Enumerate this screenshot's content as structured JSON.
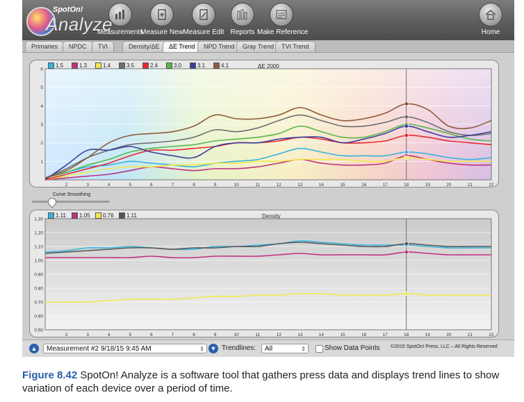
{
  "app": {
    "logo_small": "SpotOn!",
    "logo_large": "Analyze"
  },
  "toolbar": {
    "buttons": [
      {
        "label": "Measurements",
        "icon": "bar-chart-icon"
      },
      {
        "label": "Measure New",
        "icon": "document-plus-icon"
      },
      {
        "label": "Measure Edit",
        "icon": "document-edit-icon"
      },
      {
        "label": "Reports",
        "icon": "reports-icon"
      },
      {
        "label": "Make Reference",
        "icon": "reference-icon"
      }
    ],
    "home_label": "Home"
  },
  "tabs": [
    "Primaries",
    "NPDC",
    "TVI",
    "Density/ΔE",
    "ΔE Trend",
    "NPD Trend",
    "Gray Trend",
    "TVI Trend"
  ],
  "active_tab": "ΔE Trend",
  "smoothing": {
    "label": "Curve Smoothing",
    "value_fraction": 0.25
  },
  "charts": {
    "de": {
      "title": "ΔE 2000",
      "x": [
        1,
        2,
        3,
        4,
        5,
        6,
        7,
        8,
        9,
        10,
        11,
        12,
        13,
        14,
        15,
        16,
        17,
        18,
        19,
        20,
        21,
        22
      ],
      "xlim": [
        1,
        22
      ],
      "ylim": [
        0,
        6
      ],
      "yticks": [
        1,
        2,
        3,
        4,
        5,
        6
      ],
      "marker_x": 18,
      "series": [
        {
          "name": "1.5",
          "color": "#37b3dd",
          "values": [
            0.1,
            0.4,
            0.7,
            0.8,
            1.0,
            0.9,
            0.8,
            0.7,
            0.9,
            1.0,
            1.1,
            1.4,
            1.7,
            1.5,
            1.3,
            1.3,
            1.3,
            1.5,
            1.4,
            1.2,
            1.1,
            1.2
          ]
        },
        {
          "name": "1.3",
          "color": "#c0307f",
          "values": [
            0.0,
            0.1,
            0.2,
            0.3,
            0.5,
            0.7,
            0.6,
            0.5,
            0.6,
            0.6,
            0.7,
            0.9,
            1.1,
            0.9,
            0.8,
            0.8,
            0.9,
            1.3,
            1.1,
            0.9,
            0.8,
            0.8
          ]
        },
        {
          "name": "1.4",
          "color": "#f3e84a",
          "values": [
            0.0,
            0.2,
            0.4,
            0.6,
            0.7,
            0.7,
            0.8,
            0.8,
            0.9,
            0.9,
            1.0,
            1.0,
            1.1,
            1.1,
            1.1,
            1.0,
            1.0,
            1.2,
            1.1,
            1.0,
            1.0,
            1.0
          ]
        },
        {
          "name": "3.5",
          "color": "#6e6e6e",
          "values": [
            0.1,
            0.6,
            1.2,
            1.6,
            1.9,
            2.0,
            2.1,
            2.3,
            2.7,
            2.6,
            2.8,
            3.2,
            3.5,
            3.2,
            2.9,
            2.9,
            3.1,
            3.4,
            3.1,
            2.6,
            2.4,
            2.5
          ]
        },
        {
          "name": "2.4",
          "color": "#e8262e",
          "values": [
            0.0,
            0.3,
            0.6,
            0.9,
            1.3,
            1.6,
            1.6,
            1.7,
            1.8,
            2.0,
            2.0,
            2.1,
            2.3,
            2.2,
            2.0,
            2.0,
            2.1,
            2.4,
            2.3,
            2.1,
            2.0,
            1.9
          ]
        },
        {
          "name": "3.0",
          "color": "#58b849",
          "values": [
            0.1,
            0.4,
            0.8,
            1.1,
            1.5,
            1.7,
            1.8,
            1.9,
            2.1,
            2.2,
            2.3,
            2.5,
            2.9,
            2.6,
            2.3,
            2.3,
            2.6,
            3.0,
            2.8,
            2.5,
            2.2,
            2.1
          ]
        },
        {
          "name": "3.1",
          "color": "#3d3e9e",
          "values": [
            0.0,
            0.8,
            1.6,
            1.6,
            1.8,
            1.5,
            1.3,
            1.2,
            1.8,
            2.0,
            2.0,
            2.2,
            2.3,
            2.3,
            2.0,
            2.2,
            2.5,
            2.9,
            2.6,
            2.3,
            2.4,
            2.6
          ]
        },
        {
          "name": "4.1",
          "color": "#8e5a3b",
          "values": [
            0.1,
            0.5,
            1.2,
            2.0,
            2.4,
            2.5,
            2.6,
            2.9,
            3.5,
            3.3,
            3.3,
            3.5,
            3.9,
            3.5,
            3.2,
            3.3,
            3.6,
            4.1,
            3.8,
            2.9,
            2.8,
            3.2
          ]
        }
      ]
    },
    "density": {
      "title": "Density",
      "x": [
        1,
        2,
        3,
        4,
        5,
        6,
        7,
        8,
        9,
        10,
        11,
        12,
        13,
        14,
        15,
        16,
        17,
        18,
        19,
        20,
        21,
        22
      ],
      "xlim": [
        1,
        22
      ],
      "ylim": [
        0.5,
        1.3
      ],
      "yticks": [
        0.5,
        0.6,
        0.7,
        0.8,
        0.9,
        1.0,
        1.1,
        1.2,
        1.3
      ],
      "marker_x": 18,
      "series": [
        {
          "name": "1.11",
          "color": "#37b3dd",
          "values": [
            1.06,
            1.07,
            1.09,
            1.09,
            1.1,
            1.09,
            1.08,
            1.08,
            1.1,
            1.1,
            1.11,
            1.12,
            1.14,
            1.13,
            1.12,
            1.11,
            1.11,
            1.11,
            1.1,
            1.09,
            1.09,
            1.09
          ]
        },
        {
          "name": "1.05",
          "color": "#c0307f",
          "values": [
            1.02,
            1.02,
            1.02,
            1.02,
            1.02,
            1.03,
            1.02,
            1.02,
            1.03,
            1.03,
            1.03,
            1.04,
            1.05,
            1.04,
            1.04,
            1.04,
            1.04,
            1.06,
            1.05,
            1.04,
            1.04,
            1.04
          ]
        },
        {
          "name": "0.76",
          "color": "#f3e84a",
          "values": [
            0.7,
            0.7,
            0.7,
            0.71,
            0.72,
            0.72,
            0.72,
            0.73,
            0.74,
            0.74,
            0.75,
            0.75,
            0.76,
            0.76,
            0.75,
            0.75,
            0.75,
            0.76,
            0.75,
            0.75,
            0.75,
            0.75
          ]
        },
        {
          "name": "1.11",
          "color": "#555555",
          "values": [
            1.05,
            1.06,
            1.07,
            1.08,
            1.09,
            1.09,
            1.08,
            1.09,
            1.09,
            1.1,
            1.1,
            1.12,
            1.13,
            1.12,
            1.11,
            1.1,
            1.1,
            1.12,
            1.11,
            1.1,
            1.1,
            1.1
          ]
        }
      ]
    }
  },
  "bottom": {
    "measurement": "Measurement #2 9/18/15 9:45 AM",
    "trendlines_label": "Trendlines:",
    "trendlines_value": "All",
    "show_points_label": "Show Data Points",
    "copyright": "©2015 SpotOn! Press, LLC – All Rights Reserved"
  },
  "caption": {
    "fig": "Figure 8.42",
    "text": "SpotOn! Analyze is a software tool that gathers press data and displays trend lines to show variation of each device over a period of time."
  }
}
